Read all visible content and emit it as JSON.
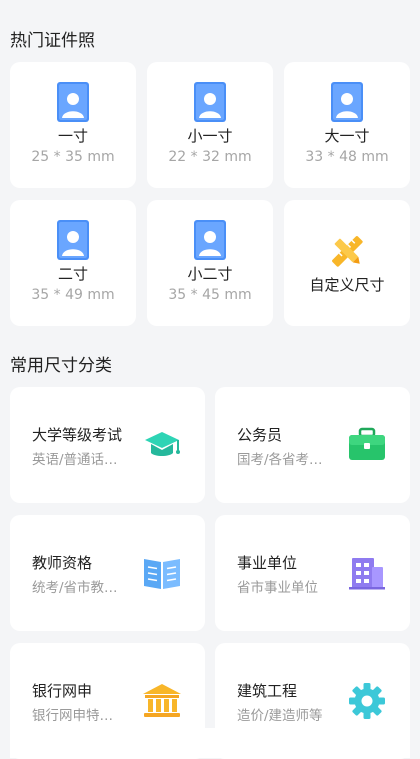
{
  "hot": {
    "title": "热门证件照",
    "items": [
      {
        "name": "一寸",
        "size": "25 * 35 mm",
        "icon": "portrait-icon"
      },
      {
        "name": "小一寸",
        "size": "22 * 32 mm",
        "icon": "portrait-icon"
      },
      {
        "name": "大一寸",
        "size": "33 * 48 mm",
        "icon": "portrait-icon"
      },
      {
        "name": "二寸",
        "size": "35 * 49 mm",
        "icon": "portrait-icon"
      },
      {
        "name": "小二寸",
        "size": "35 * 45 mm",
        "icon": "portrait-icon"
      },
      {
        "name": "自定义尺寸",
        "icon": "ruler-pencil-icon"
      }
    ]
  },
  "categories": {
    "title": "常用尺寸分类",
    "items": [
      {
        "title": "大学等级考试",
        "sub": "英语/普通话…",
        "icon": "graduation-cap-icon"
      },
      {
        "title": "公务员",
        "sub": "国考/各省考…",
        "icon": "briefcase-icon"
      },
      {
        "title": "教师资格",
        "sub": "统考/省市教…",
        "icon": "open-book-icon"
      },
      {
        "title": "事业单位",
        "sub": "省市事业单位",
        "icon": "office-building-icon"
      },
      {
        "title": "银行网申",
        "sub": "银行网申特…",
        "icon": "bank-icon"
      },
      {
        "title": "建筑工程",
        "sub": "造价/建造师等",
        "icon": "gear-icon"
      }
    ]
  },
  "colors": {
    "portrait_blue": "#4a8ff7",
    "accent_yellow": "#f8b629",
    "teal": "#2ed4b5",
    "green": "#27c46b",
    "sky_blue": "#5aa8f5",
    "purple": "#8f7bf0",
    "cyan": "#3cc8d8"
  }
}
